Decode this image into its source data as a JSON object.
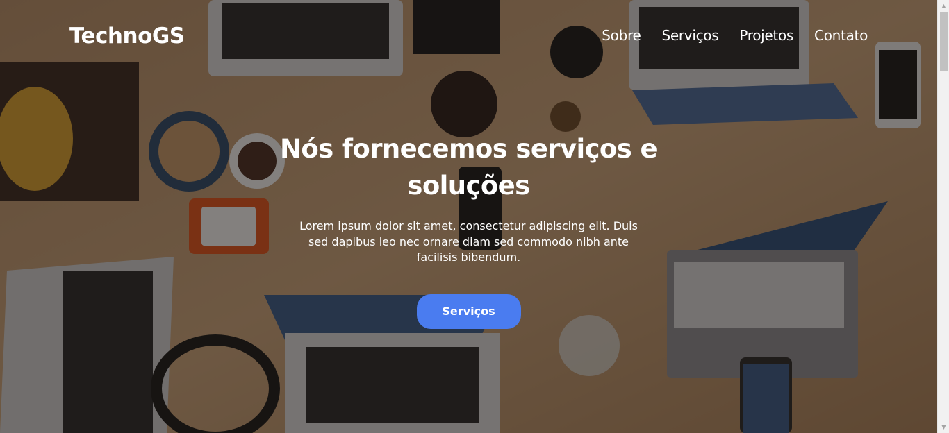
{
  "brand": {
    "name": "TechnoGS"
  },
  "nav": {
    "items": [
      {
        "label": "Sobre"
      },
      {
        "label": "Serviços"
      },
      {
        "label": "Projetos"
      },
      {
        "label": "Contato"
      }
    ]
  },
  "hero": {
    "title": "Nós fornecemos serviços e soluções",
    "text": "Lorem ipsum dolor sit amet, consectetur adipiscing elit. Duis sed dapibus leo nec ornare diam sed commodo nibh ante facilisis bibendum.",
    "button_label": "Serviços",
    "background_image": "overhead-desk-with-laptops-photo"
  },
  "colors": {
    "accent": "#4a7cf0",
    "text": "#ffffff",
    "overlay": "rgba(20,14,10,0.5)"
  },
  "scrollbar": {
    "up_icon": "▲",
    "down_icon": "▼"
  }
}
